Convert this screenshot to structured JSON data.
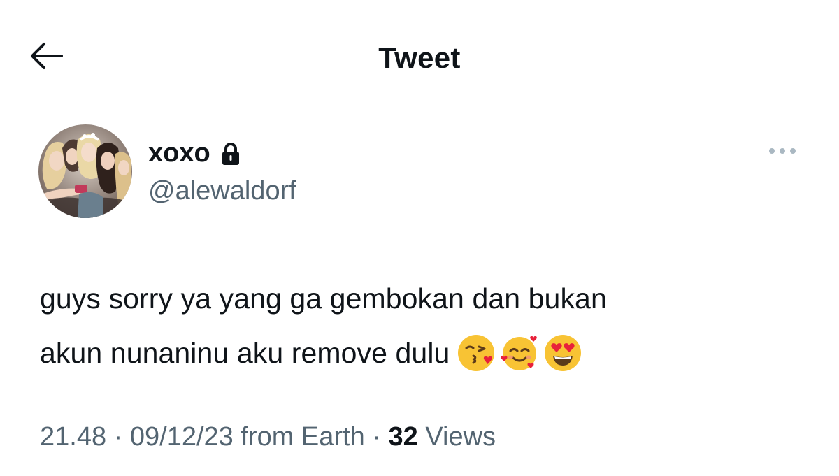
{
  "header": {
    "back_icon": "arrow-left-icon",
    "title": "Tweet"
  },
  "author": {
    "display_name": "xoxo",
    "protected_icon": "lock-icon",
    "handle": "@alewaldorf",
    "avatar": "group-selfie-photo"
  },
  "more_icon": "more-horizontal-icon",
  "tweet": {
    "line1": "guys sorry ya yang ga gembokan dan bukan",
    "line2": "akun nunaninu aku remove dulu",
    "emojis": [
      "face-blowing-a-kiss-emoji",
      "smiling-face-with-hearts-emoji",
      "smiling-face-with-heart-eyes-emoji"
    ]
  },
  "meta": {
    "time": "21.48",
    "separator": "·",
    "date": "09/12/23",
    "source": "from Earth",
    "views_count": "32",
    "views_label": "Views"
  },
  "colors": {
    "text_primary": "#0f1419",
    "text_secondary": "#536471",
    "more_dots": "#aab8c2",
    "background": "#ffffff"
  }
}
